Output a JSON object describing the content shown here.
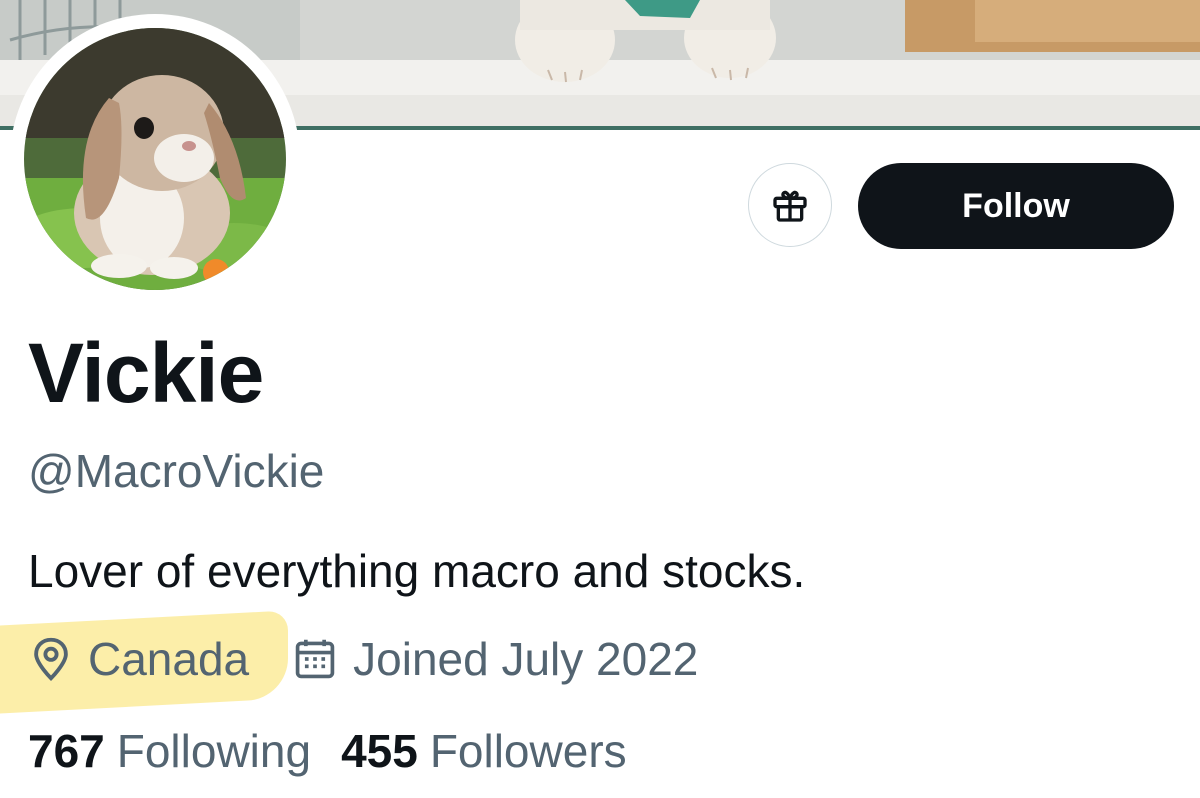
{
  "profile": {
    "display_name": "Vickie",
    "handle": "@MacroVickie",
    "bio": "Lover of everything macro and stocks.",
    "location": "Canada",
    "joined": "Joined July 2022"
  },
  "stats": {
    "following_count": "767",
    "following_label": "Following",
    "followers_count": "455",
    "followers_label": "Followers"
  },
  "actions": {
    "follow_label": "Follow",
    "gift_icon": "gift-icon"
  },
  "icons": {
    "location": "location-pin-icon",
    "calendar": "calendar-icon"
  },
  "colors": {
    "primary_text": "#0f1419",
    "secondary_text": "#536471",
    "follow_bg": "#0f1419",
    "highlight": "#fbe88c"
  }
}
